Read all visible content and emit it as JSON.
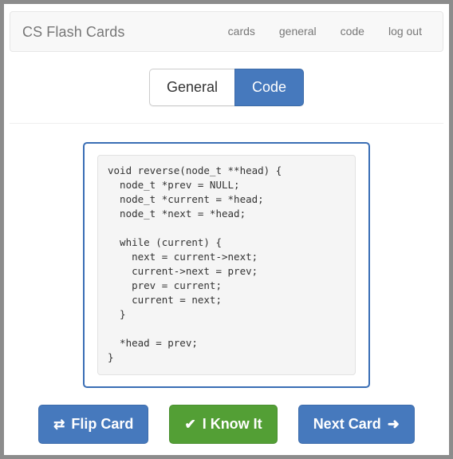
{
  "navbar": {
    "brand": "CS Flash Cards",
    "links": [
      {
        "label": "cards"
      },
      {
        "label": "general"
      },
      {
        "label": "code"
      },
      {
        "label": "log out"
      }
    ]
  },
  "mode_toggle": {
    "options": [
      {
        "label": "General",
        "active": false
      },
      {
        "label": "Code",
        "active": true
      }
    ],
    "selected": "Code",
    "active_color": "#4679bd"
  },
  "card": {
    "border_color": "#3a6eb5",
    "code_background": "#f5f5f5",
    "code": "void reverse(node_t **head) {\n  node_t *prev = NULL;\n  node_t *current = *head;\n  node_t *next = *head;\n\n  while (current) {\n    next = current->next;\n    current->next = prev;\n    prev = current;\n    current = next;\n  }\n\n  *head = prev;\n}"
  },
  "actions": [
    {
      "label": "Flip Card",
      "icon": "⇄",
      "icon_name": "exchange-icon",
      "color": "#4679bd"
    },
    {
      "label": "I Know It",
      "icon": "✔",
      "icon_name": "check-icon",
      "color": "#539f35"
    },
    {
      "label": "Next Card",
      "icon": "➜",
      "icon_name": "arrow-right-icon",
      "color": "#4679bd"
    }
  ]
}
